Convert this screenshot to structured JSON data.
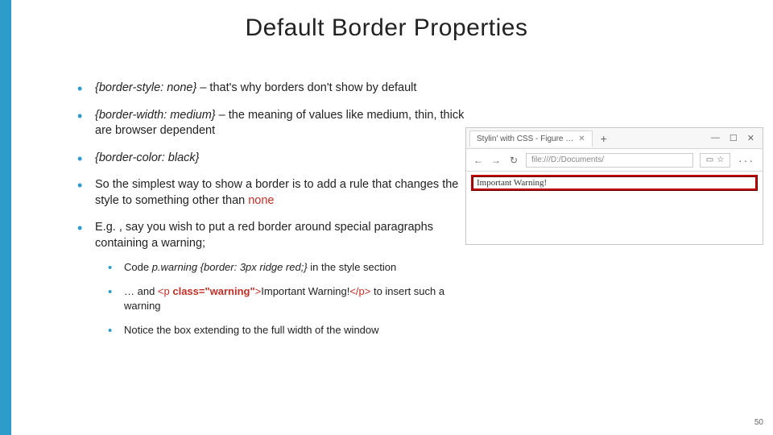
{
  "title": "Default Border Properties",
  "bullets": {
    "b1a": "{border-style: none}",
    "b1b": " – that's why borders don't show by default",
    "b2a": "{border-width: medium}",
    "b2b": " – the meaning of values like medium, thin, thick are browser dependent",
    "b3": "{border-color: black}",
    "b4a": "So the simplest way to show a border is to add a rule that changes the style to something other than ",
    "b4b": "none",
    "b5": "E.g. , say you wish to put a red border around special paragraphs containing a warning;",
    "s1a": "Code ",
    "s1b": "p.warning {border: 3px ridge red;}",
    "s1c": " in the style section",
    "s2a": "… and ",
    "s2b": "<p ",
    "s2c": "class=\"warning\"",
    "s2d": ">",
    "s2e": "Important Warning!",
    "s2f": "</p>",
    "s2g": " to insert such a warning",
    "s3": "Notice the box extending to the full width of the window"
  },
  "browser": {
    "tab_title": "Stylin' with CSS - Figure …",
    "plus": "+",
    "min": "—",
    "max": "☐",
    "close": "✕",
    "back": "←",
    "fwd": "→",
    "refresh": "↻",
    "url": "file:///D:/Documents/",
    "book": "▭",
    "star": "☆",
    "more": "···",
    "warning_text": "Important Warning!"
  },
  "pagenum": "50"
}
